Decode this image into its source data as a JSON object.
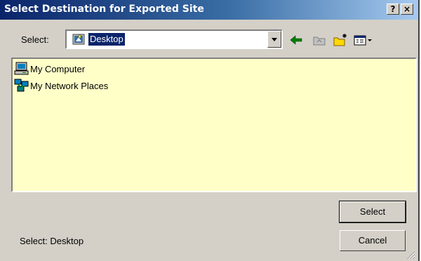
{
  "window": {
    "title": "Select Destination for Exported Site",
    "help_button": "?",
    "close_button": "×"
  },
  "toolbar": {
    "select_label": "Select:",
    "current_location": "Desktop",
    "icons": [
      "back-arrow-icon",
      "up-folder-icon",
      "new-folder-icon",
      "view-menu-icon"
    ]
  },
  "file_list": {
    "items": [
      {
        "label": "My Computer",
        "icon": "computer-icon"
      },
      {
        "label": "My Network Places",
        "icon": "network-places-icon"
      }
    ],
    "background_color": "#ffffc8"
  },
  "buttons": {
    "select": "Select",
    "cancel": "Cancel"
  },
  "status": {
    "text": "Select: Desktop"
  },
  "colors": {
    "titlebar_start": "#0a246a",
    "titlebar_end": "#a6caf0",
    "dialog_face": "#d4d0c8"
  }
}
